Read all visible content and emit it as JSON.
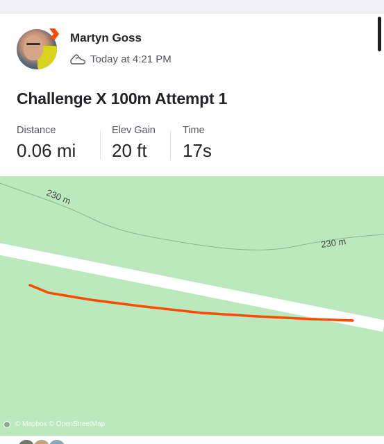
{
  "post": {
    "athlete_name": "Martyn Goss",
    "timestamp": "Today at 4:21 PM",
    "activity_type_icon": "shoe-icon",
    "title": "Challenge X 100m Attempt 1"
  },
  "stats": [
    {
      "label": "Distance",
      "value": "0.06 mi"
    },
    {
      "label": "Elev Gain",
      "value": "20 ft"
    },
    {
      "label": "Time",
      "value": "17s"
    }
  ],
  "map": {
    "contour_label_1": "230 m",
    "contour_label_2": "230 m",
    "attribution": "© Mapbox © OpenStreetMap",
    "route_color": "#fc4c02",
    "background_color": "#bce8bd",
    "road_color": "#ffffff"
  },
  "colors": {
    "brand": "#fc4c02",
    "text_primary": "#242428",
    "text_secondary": "#55555c"
  }
}
